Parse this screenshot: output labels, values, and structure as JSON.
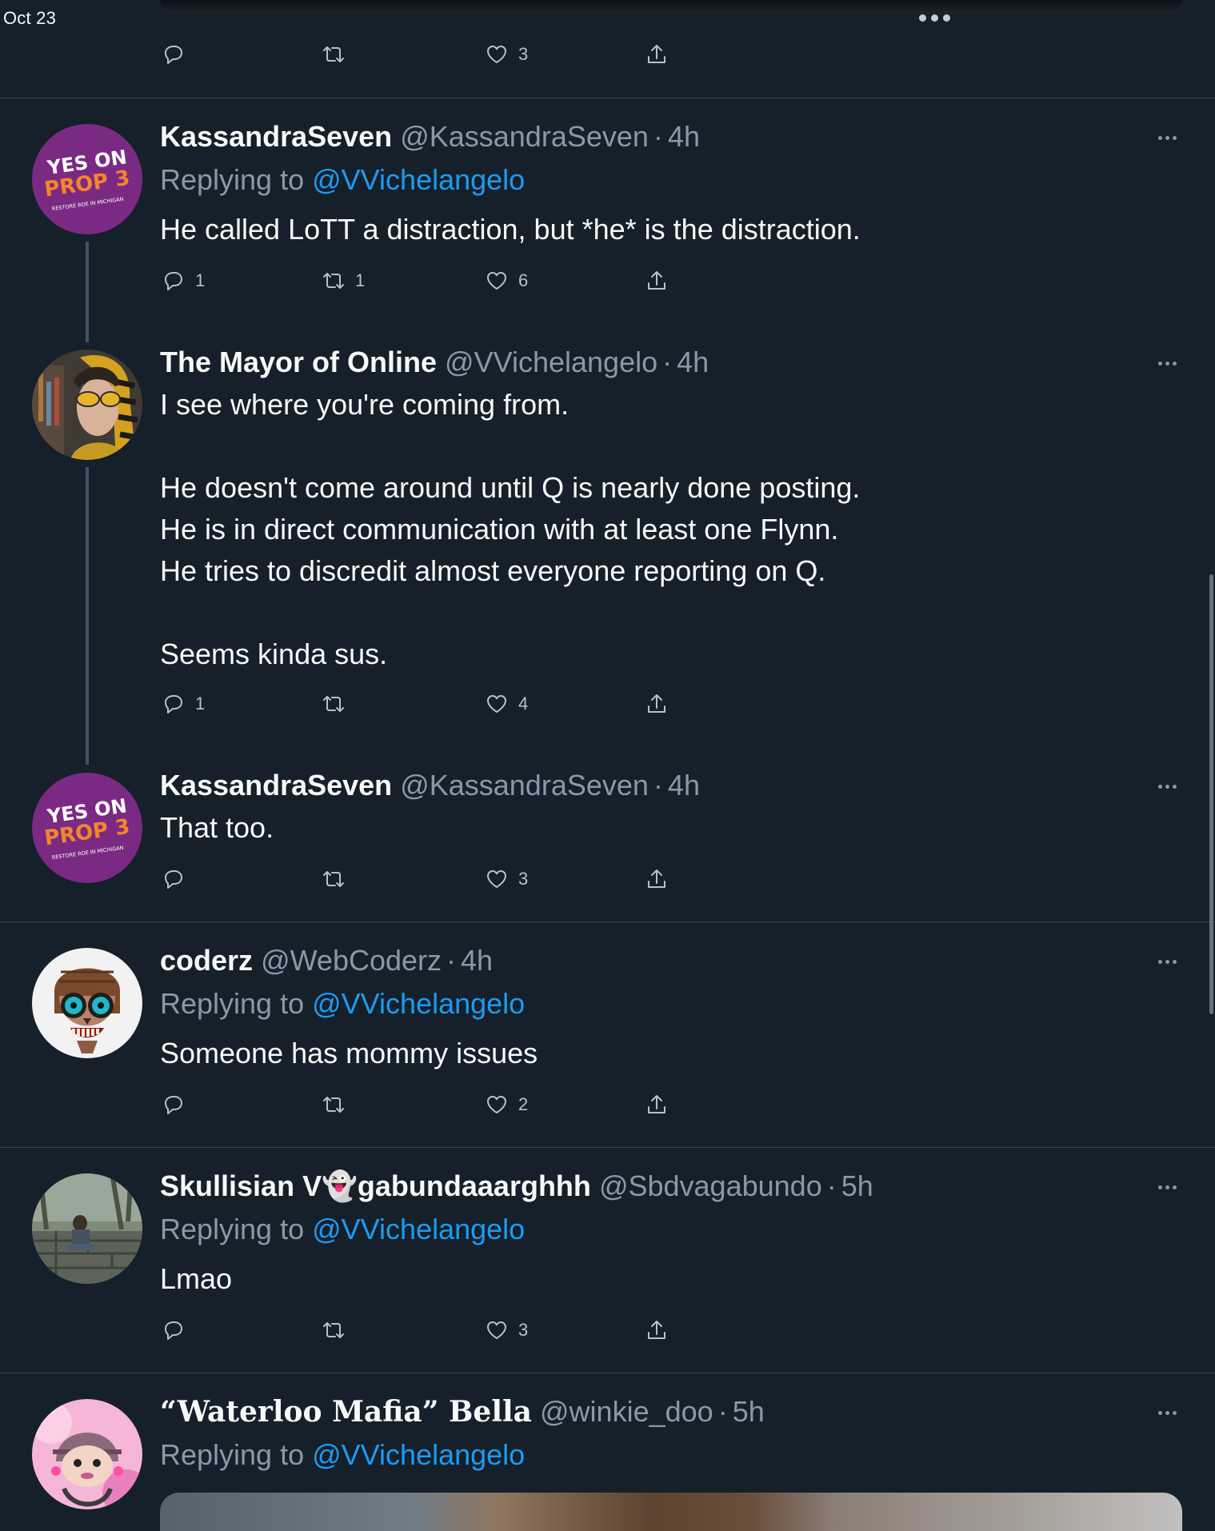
{
  "status_bar": {
    "date": "Oct 23"
  },
  "colors": {
    "background": "#15202b",
    "accent": "#1d9bf0",
    "muted": "#8b98a5",
    "divider": "#38444d"
  },
  "top_tweet_actions": {
    "reply_count": "",
    "retweet_count": "",
    "like_count": "3"
  },
  "tweets": [
    {
      "name": "KassandraSeven",
      "handle": "@KassandraSeven",
      "time": "4h",
      "replying_prefix": "Replying to",
      "replying_to": "@VVichelangelo",
      "text": "He called LoTT a distraction, but *he* is the distraction.",
      "reply_count": "1",
      "retweet_count": "1",
      "like_count": "6",
      "avatar": {
        "line1": "YES ON",
        "line2": "PROP 3",
        "line3": "RESTORE ROE IN MICHIGAN"
      }
    },
    {
      "name": "The Mayor of Online",
      "handle": "@VVichelangelo",
      "time": "4h",
      "text": "I see where you're coming from.\n\nHe doesn't come around until Q is nearly done posting.\nHe is in direct communication with at least one Flynn.\nHe tries to discredit almost everyone reporting on Q.\n\nSeems kinda sus.",
      "reply_count": "1",
      "retweet_count": "",
      "like_count": "4"
    },
    {
      "name": "KassandraSeven",
      "handle": "@KassandraSeven",
      "time": "4h",
      "text": "That too.",
      "reply_count": "",
      "retweet_count": "",
      "like_count": "3",
      "avatar": {
        "line1": "YES ON",
        "line2": "PROP 3",
        "line3": "RESTORE ROE IN MICHIGAN"
      }
    },
    {
      "name": "coderz",
      "handle": "@WebCoderz",
      "time": "4h",
      "replying_prefix": "Replying to",
      "replying_to": "@VVichelangelo",
      "text": "Someone has mommy issues",
      "reply_count": "",
      "retweet_count": "",
      "like_count": "2"
    },
    {
      "name": "Skullisian V👻gabundaaarghhh",
      "handle": "@Sbdvagabundo",
      "time": "5h",
      "replying_prefix": "Replying to",
      "replying_to": "@VVichelangelo",
      "text": "Lmao",
      "reply_count": "",
      "retweet_count": "",
      "like_count": "3"
    },
    {
      "name": "“Waterloo Mafia” Bella",
      "handle": "@winkie_doo",
      "time": "5h",
      "replying_prefix": "Replying to",
      "replying_to": "@VVichelangelo"
    }
  ],
  "separator": "·"
}
